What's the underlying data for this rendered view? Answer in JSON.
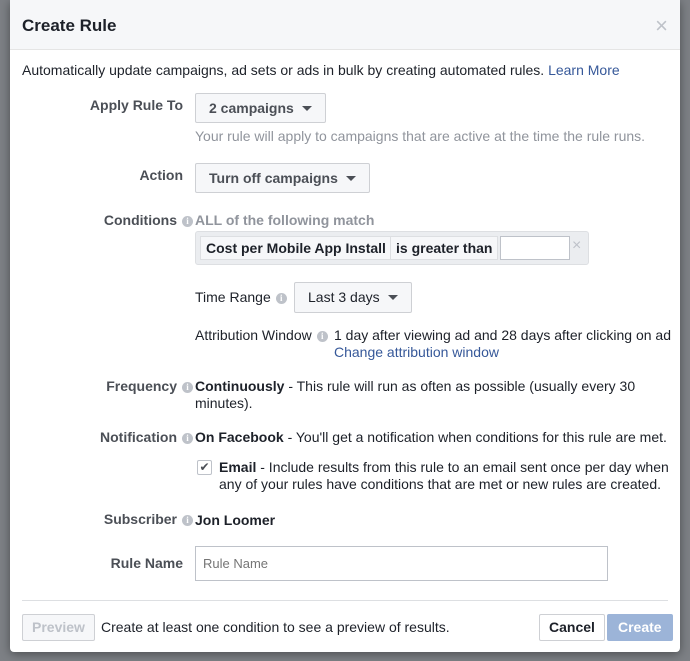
{
  "dialog": {
    "title": "Create Rule",
    "close_icon": "close-icon"
  },
  "intro": {
    "text": "Automatically update campaigns, ad sets or ads in bulk by creating automated rules.",
    "link": "Learn More"
  },
  "apply_rule": {
    "label": "Apply Rule To",
    "value": "2 campaigns",
    "help": "Your rule will apply to campaigns that are active at the time the rule runs."
  },
  "action": {
    "label": "Action",
    "value": "Turn off campaigns"
  },
  "conditions": {
    "label": "Conditions",
    "match": "ALL of the following match",
    "metric": "Cost per Mobile App Install",
    "operator": "is greater than",
    "value": ""
  },
  "time_range": {
    "label": "Time Range",
    "value": "Last 3 days"
  },
  "attribution": {
    "label": "Attribution Window",
    "value": "1 day after viewing ad and 28 days after clicking on ad",
    "link": "Change attribution window"
  },
  "frequency": {
    "label": "Frequency",
    "bold": "Continuously",
    "line1": " - This rule will run as often as possible (usually every 30",
    "line2": "minutes)."
  },
  "notification": {
    "label": "Notification",
    "bold": "On Facebook",
    "text": " - You'll get a notification when conditions for this rule are met.",
    "email_checked": true,
    "email_bold": "Email",
    "email_line1": " - Include results from this rule to an email sent once per day when",
    "email_line2": "any of your rules have conditions that are met or new rules are created."
  },
  "subscriber": {
    "label": "Subscriber",
    "value": "Jon Loomer"
  },
  "rule_name": {
    "label": "Rule Name",
    "placeholder": "Rule Name",
    "value": ""
  },
  "footer": {
    "preview": "Preview",
    "hint": "Create at least one condition to see a preview of results.",
    "cancel": "Cancel",
    "create": "Create"
  },
  "colors": {
    "accent": "#4267b2",
    "create_disabled": "#9cb4d8",
    "link": "#365899"
  }
}
